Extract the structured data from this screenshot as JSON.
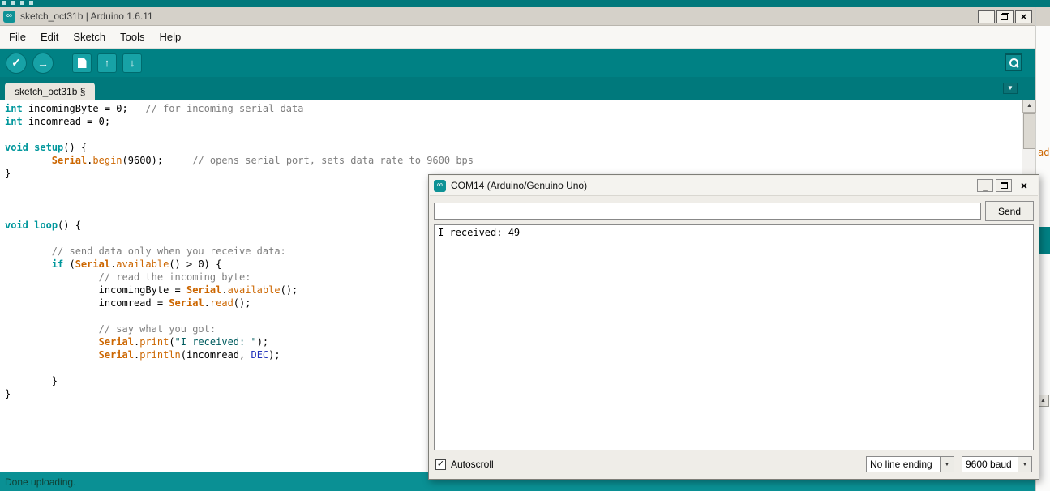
{
  "background": {
    "fragment_code_text": "ad",
    "fragment_scroll_glyph": "▲"
  },
  "window": {
    "title": "sketch_oct31b | Arduino 1.6.11",
    "minimize_glyph": "_",
    "close_glyph": "×"
  },
  "menubar": {
    "items": [
      "File",
      "Edit",
      "Sketch",
      "Tools",
      "Help"
    ]
  },
  "toolbar": {
    "verify_glyph": "✓",
    "upload_glyph": "→",
    "open_glyph": "↑",
    "save_glyph": "↓"
  },
  "tabbar": {
    "active_tab": "sketch_oct31b §",
    "dropdown_glyph": "▼"
  },
  "editor": {
    "lines": [
      [
        [
          "kw",
          "int"
        ],
        [
          "pl",
          " incomingByte = 0;   "
        ],
        [
          "cm",
          "// for incoming serial data"
        ]
      ],
      [
        [
          "kw",
          "int"
        ],
        [
          "pl",
          " incomread = 0;"
        ]
      ],
      [],
      [
        [
          "kw",
          "void"
        ],
        [
          "pl",
          " "
        ],
        [
          "kw",
          "setup"
        ],
        [
          "pl",
          "() {"
        ]
      ],
      [
        [
          "pl",
          "        "
        ],
        [
          "ser",
          "Serial"
        ],
        [
          "pl",
          "."
        ],
        [
          "fn",
          "begin"
        ],
        [
          "pl",
          "(9600);     "
        ],
        [
          "cm",
          "// opens serial port, sets data rate to 9600 bps"
        ]
      ],
      [
        [
          "pl",
          "}"
        ]
      ],
      [],
      [],
      [],
      [
        [
          "kw",
          "void"
        ],
        [
          "pl",
          " "
        ],
        [
          "kw",
          "loop"
        ],
        [
          "pl",
          "() {"
        ]
      ],
      [],
      [
        [
          "pl",
          "        "
        ],
        [
          "cm",
          "// send data only when you receive data:"
        ]
      ],
      [
        [
          "pl",
          "        "
        ],
        [
          "kw",
          "if"
        ],
        [
          "pl",
          " ("
        ],
        [
          "ser",
          "Serial"
        ],
        [
          "pl",
          "."
        ],
        [
          "fn",
          "available"
        ],
        [
          "pl",
          "() > 0) {"
        ]
      ],
      [
        [
          "pl",
          "                "
        ],
        [
          "cm",
          "// read the incoming byte:"
        ]
      ],
      [
        [
          "pl",
          "                incomingByte = "
        ],
        [
          "ser",
          "Serial"
        ],
        [
          "pl",
          "."
        ],
        [
          "fn",
          "available"
        ],
        [
          "pl",
          "();"
        ]
      ],
      [
        [
          "pl",
          "                incomread = "
        ],
        [
          "ser",
          "Serial"
        ],
        [
          "pl",
          "."
        ],
        [
          "fn",
          "read"
        ],
        [
          "pl",
          "();"
        ]
      ],
      [],
      [
        [
          "pl",
          "                "
        ],
        [
          "cm",
          "// say what you got:"
        ]
      ],
      [
        [
          "pl",
          "                "
        ],
        [
          "ser",
          "Serial"
        ],
        [
          "pl",
          "."
        ],
        [
          "fn",
          "print"
        ],
        [
          "pl",
          "("
        ],
        [
          "str",
          "\"I received: \""
        ],
        [
          "pl",
          ");"
        ]
      ],
      [
        [
          "pl",
          "                "
        ],
        [
          "ser",
          "Serial"
        ],
        [
          "pl",
          "."
        ],
        [
          "fn",
          "println"
        ],
        [
          "pl",
          "(incomread, "
        ],
        [
          "cst",
          "DEC"
        ],
        [
          "pl",
          ");"
        ]
      ],
      [],
      [
        [
          "pl",
          "        }"
        ]
      ],
      [
        [
          "pl",
          "}"
        ]
      ]
    ]
  },
  "scrollbar": {
    "up_glyph": "▲",
    "down_glyph": "▼"
  },
  "statusbar": {
    "message": "Done uploading."
  },
  "serial_monitor": {
    "title": "COM14 (Arduino/Genuino Uno)",
    "minimize_glyph": "_",
    "close_glyph": "×",
    "input_value": "",
    "send_label": "Send",
    "output": "I received: 49",
    "autoscroll": {
      "label": "Autoscroll",
      "checked": true,
      "checkmark": "✓"
    },
    "line_ending_value": "No line ending",
    "baud_value": "9600 baud",
    "combo_arrow": "▼"
  },
  "icons": {
    "arduino_logo": "∞"
  }
}
